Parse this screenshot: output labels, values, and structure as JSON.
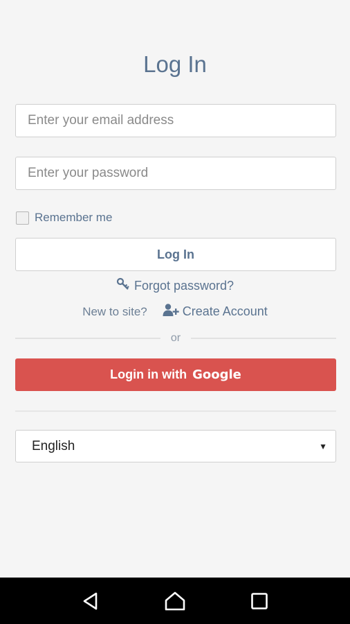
{
  "page": {
    "title": "Log In"
  },
  "form": {
    "email_placeholder": "Enter your email address",
    "password_placeholder": "Enter your password",
    "remember_label": "Remember me",
    "remember_checked": false,
    "login_label": "Log In",
    "forgot_label": "Forgot password?",
    "new_to_site": "New to site?",
    "create_account_label": "Create Account",
    "or_label": "or",
    "google_prefix": "Login in with",
    "google_brand": "Google"
  },
  "language": {
    "selected": "English"
  },
  "icons": {
    "forgot": "key-icon",
    "create": "add-user-icon",
    "nav_back": "back-triangle-icon",
    "nav_home": "home-icon",
    "nav_recents": "recents-square-icon"
  },
  "colors": {
    "accent": "#5a7390",
    "google": "#d9534f",
    "background": "#f5f5f5",
    "navbar": "#000000"
  }
}
